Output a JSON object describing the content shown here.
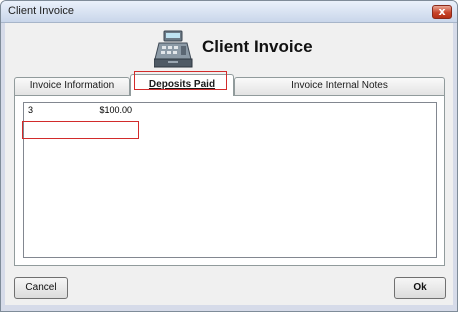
{
  "window": {
    "title": "Client Invoice",
    "close_glyph": "x"
  },
  "header": {
    "title": "Client Invoice",
    "icon": "cash-register-icon"
  },
  "tabs": [
    {
      "label": "Invoice Information",
      "selected": false
    },
    {
      "label": "Deposits Paid",
      "selected": true
    },
    {
      "label": "Invoice Internal Notes",
      "selected": false
    }
  ],
  "deposits": [
    {
      "number": "3",
      "amount": "$100.00"
    }
  ],
  "buttons": {
    "cancel": "Cancel",
    "ok": "Ok"
  },
  "colors": {
    "highlight": "#d22b2b",
    "close_button": "#c8442a"
  }
}
